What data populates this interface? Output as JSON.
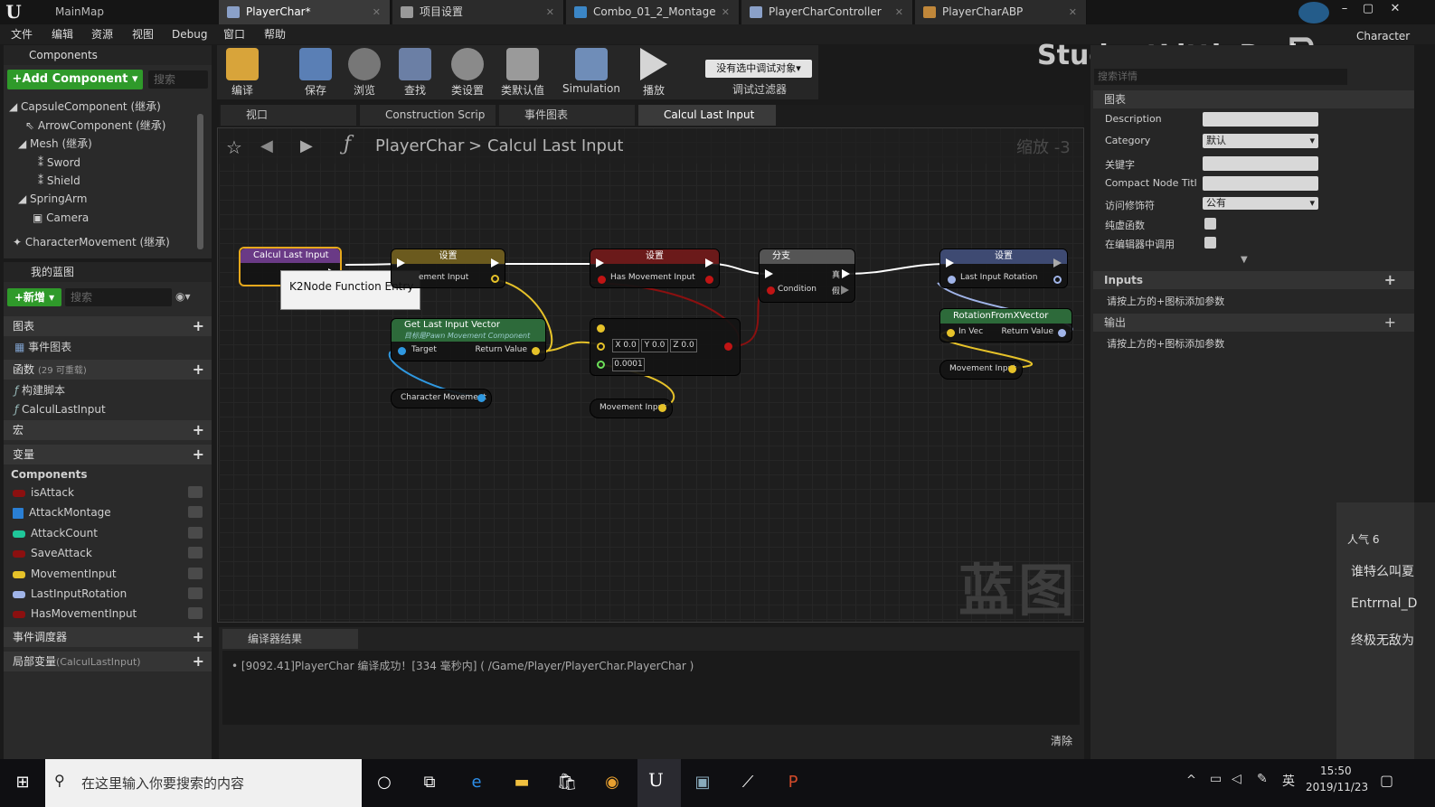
{
  "titlebar": {
    "map_tab": "MainMap",
    "tabs": [
      "PlayerChar*",
      "项目设置",
      "Combo_01_2_Montage",
      "PlayerCharController",
      "PlayerCharABP"
    ],
    "right_label": "Character"
  },
  "menu": [
    "文件",
    "编辑",
    "资源",
    "视图",
    "Debug",
    "窗口",
    "帮助"
  ],
  "components": {
    "header": "Components",
    "add_button": "+Add Component ▾",
    "search_placeholder": "搜索",
    "tree": [
      "CapsuleComponent (继承)",
      "ArrowComponent (继承)",
      "Mesh (继承)",
      "Sword",
      "Shield",
      "SpringArm",
      "Camera",
      "CharacterMovement (继承)"
    ]
  },
  "my_blueprint": {
    "header": "我的蓝图",
    "new_button": "+新增 ▾",
    "search_placeholder": "搜索",
    "graphs_label": "图表",
    "event_graph": "事件图表",
    "functions_label": "函数",
    "functions_count": "(29 可重载)",
    "construction_script": "构建脚本",
    "function_item": "CalculLastInput",
    "macros_label": "宏",
    "variables_label": "变量",
    "components_group": "Components",
    "variables": [
      {
        "name": "isAttack",
        "color": "#8b1010"
      },
      {
        "name": "AttackMontage",
        "color": "#2a7fd4"
      },
      {
        "name": "AttackCount",
        "color": "#1fc79a"
      },
      {
        "name": "SaveAttack",
        "color": "#8b1010"
      },
      {
        "name": "MovementInput",
        "color": "#e6c229"
      },
      {
        "name": "LastInputRotation",
        "color": "#a0b4e8"
      },
      {
        "name": "HasMovementInput",
        "color": "#8b1010"
      }
    ],
    "dispatchers_label": "事件调度器",
    "local_vars_label": "局部变量",
    "local_vars_scope": "(CalculLastInput)"
  },
  "toolbar": {
    "buttons": [
      "编译",
      "保存",
      "浏览",
      "查找",
      "类设置",
      "类默认值",
      "Simulation",
      "播放"
    ],
    "debug_select": "没有选中调试对象▾",
    "debug_filter": "调试过滤器"
  },
  "graph_tabs": [
    "视口",
    "Construction Scrip",
    "事件图表",
    "Calcul Last Input"
  ],
  "breadcrumb": {
    "root": "PlayerChar",
    "sep": ">",
    "current": "Calcul Last Input",
    "zoom": "缩放 -3"
  },
  "nodes": {
    "entry_title": "Calcul Last Input",
    "tooltip": "K2Node Function Entry",
    "set1_title": "设置",
    "set1_pin": "ement Input",
    "set2_title": "设置",
    "set2_pin": "Has Movement Input",
    "branch_title": "分支",
    "branch_condition": "Condition",
    "branch_true": "真",
    "branch_false": "假",
    "set3_title": "设置",
    "set3_pin": "Last Input Rotation",
    "get_last_title": "Get Last Input Vector",
    "get_last_subtitle": "目标是Pawn Movement Component",
    "get_last_target": "Target",
    "get_last_return": "Return Value",
    "char_movement": "Character Movement",
    "compare_x": "X 0.0",
    "compare_y": "Y 0.0",
    "compare_z": "Z 0.0",
    "compare_tol": "0.0001",
    "movement_input_get": "Movement Input",
    "rot_title": "RotationFromXVector",
    "rot_in": "In Vec",
    "rot_return": "Return Value",
    "movement_input_get2": "Movement Input"
  },
  "watermark_graph": "蓝图",
  "watermark_user": "StudentLittleRed",
  "compiler": {
    "tab": "编译器结果",
    "message": "[9092.41]PlayerChar 编译成功！[334 毫秒内] ( /Game/Player/PlayerChar.PlayerChar )",
    "clear": "清除"
  },
  "details": {
    "search_placeholder": "搜索详情",
    "section_graph": "图表",
    "rows": [
      {
        "label": "Description",
        "value": ""
      },
      {
        "label": "Category",
        "value": "默认"
      },
      {
        "label": "关键字",
        "value": ""
      },
      {
        "label": "Compact Node Titl",
        "value": ""
      },
      {
        "label": "访问修饰符",
        "value": "公有"
      },
      {
        "label": "纯虚函数",
        "value": ""
      },
      {
        "label": "在编辑器中调用",
        "value": ""
      }
    ],
    "inputs_label": "Inputs",
    "inputs_hint": "请按上方的+图标添加参数",
    "outputs_label": "输出",
    "outputs_hint": "请按上方的+图标添加参数"
  },
  "overlay_chat": {
    "popularity": "人气 6",
    "lines": [
      "谁特么叫夏",
      "Entrrnal_D",
      "终极无敌为"
    ]
  },
  "taskbar": {
    "search_placeholder": "在这里输入你要搜索的内容",
    "ime": "英",
    "time": "15:50",
    "date": "2019/11/23"
  }
}
